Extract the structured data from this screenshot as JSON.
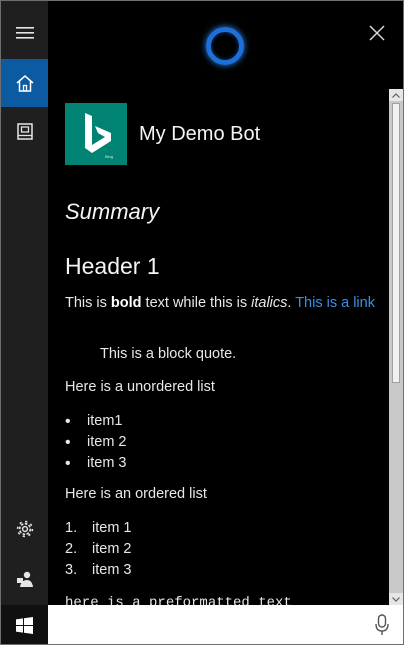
{
  "bot": {
    "name": "My Demo Bot",
    "logo_caption": "Bing"
  },
  "card": {
    "summary": "Summary",
    "header": "Header 1",
    "para_text1": "This is ",
    "para_bold": "bold",
    "para_text2": " text while this is ",
    "para_italic": "italics",
    "para_text3": ". ",
    "para_link": "This is a link",
    "block_quote": "This is a block quote.",
    "unordered_heading": "Here is a unordered list",
    "unordered_items": [
      "item1",
      "item 2",
      "item 3"
    ],
    "ordered_heading": "Here is an ordered list",
    "ordered_items": [
      {
        "num": "1.",
        "label": "item 1"
      },
      {
        "num": "2.",
        "label": "item 2"
      },
      {
        "num": "3.",
        "label": "item 3"
      }
    ],
    "preformatted": "here is a preformatted text"
  },
  "bullet": "•",
  "icons": {
    "rail": [
      "hamburger-icon",
      "home-icon",
      "notebook-icon",
      "gear-icon",
      "feedback-icon"
    ],
    "header": [
      "cortana-circle-icon",
      "close-icon"
    ],
    "taskbar": [
      "windows-logo-icon",
      "microphone-icon"
    ]
  },
  "colors": {
    "accent": "#0b5aa2",
    "cortana_ring": "#1e6fd6",
    "link": "#3b8ee8",
    "bing_teal": "#008373",
    "background": "#000000",
    "rail": "#1f1f1f"
  }
}
